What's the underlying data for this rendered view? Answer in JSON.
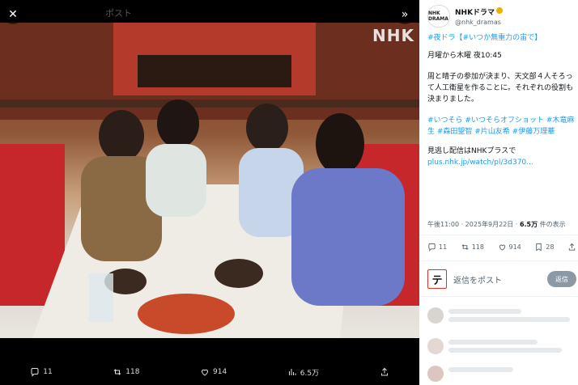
{
  "viewer": {
    "title": "ポスト",
    "watermark": "NHK",
    "close_icon": "close-icon",
    "expand_icon": "chevron-right-double-icon",
    "stats": {
      "replies": "11",
      "reposts": "118",
      "likes": "914",
      "views": "6.5万"
    }
  },
  "post": {
    "author_name": "NHKドラマ",
    "author_handle": "@nhk_dramas",
    "avatar_text": "NHK DRAMA",
    "lines": [
      "#夜ドラ【#いつか無重力の宙で】",
      "月曜から木曜 夜10:45",
      "周と晴子の参加が決まり、天文部４人そろって人工衛星を作ることに。それぞれの役割も決まりました。",
      "#いつそら #いつそらオフショット #木竜麻生 #森田望智 #片山友希 #伊藤万理華",
      "見逃し配信はNHKプラスで",
      "plus.nhk.jp/watch/pl/3d370..."
    ],
    "timestamp": "午後11:00 · 2025年9月22日 · ",
    "views_count": "6.5万",
    "views_label": " 件の表示",
    "actions": {
      "replies": "11",
      "reposts": "118",
      "likes": "914",
      "bookmarks": "28"
    }
  },
  "reply": {
    "placeholder": "返信をポスト",
    "button_label": "返信",
    "user_avatar": "テ"
  },
  "colors": {
    "accent": "#1d9bf0",
    "text": "#0f1419",
    "muted": "#536471"
  }
}
